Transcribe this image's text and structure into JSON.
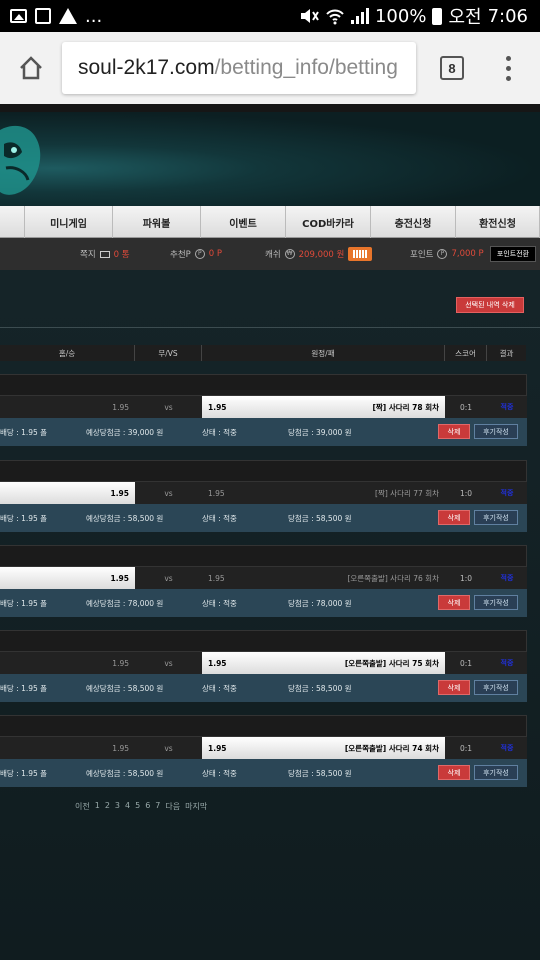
{
  "statusbar": {
    "dots": "...",
    "battery": "100%",
    "ampm": "오전",
    "time": "7:06"
  },
  "browser": {
    "url_host": "soul-2k17.com",
    "url_path": "/betting_info/betting",
    "tab_count": "8"
  },
  "nav": {
    "items": [
      "미니게임",
      "파워볼",
      "이벤트",
      "COD바카라",
      "충전신청",
      "환전신청"
    ]
  },
  "infobar": {
    "memo_label": "쪽지",
    "memo_value": "0 통",
    "recommend_label": "추천P",
    "recommend_value": "0 P",
    "cash_label": "캐쉬",
    "cash_value": "209,000 원",
    "point_label": "포인트",
    "point_value": "7,000 P",
    "point_button": "포인트전환"
  },
  "actions": {
    "delete_selected": "선택된 내역 삭제"
  },
  "table": {
    "headers": [
      "홈/승",
      "무/VS",
      "원정/패",
      "스코어",
      "결과"
    ]
  },
  "bets": [
    {
      "home_odds": "1.95",
      "vs": "vs",
      "away_odds": "1.95",
      "away_label": "[짝] 사다리 78 회차",
      "selected": "away",
      "score": "0:1",
      "result": "적중",
      "info_left": "배당 : 1.95 폴",
      "expected": "예상당첨금 : 39,000 원",
      "status": "상태 : 적중",
      "won": "당첨금 : 39,000 원",
      "delete": "삭제",
      "review": "후기작성"
    },
    {
      "home_odds": "1.95",
      "vs": "vs",
      "away_odds": "1.95",
      "away_label": "[짝] 사다리 77 회차",
      "selected": "home",
      "score": "1:0",
      "result": "적중",
      "info_left": "배당 : 1.95 폴",
      "expected": "예상당첨금 : 58,500 원",
      "status": "상태 : 적중",
      "won": "당첨금 : 58,500 원",
      "delete": "삭제",
      "review": "후기작성"
    },
    {
      "home_odds": "1.95",
      "vs": "vs",
      "away_odds": "1.95",
      "away_label": "[오른쪽출발] 사다리 76 회차",
      "selected": "home",
      "score": "1:0",
      "result": "적중",
      "info_left": "배당 : 1.95 폴",
      "expected": "예상당첨금 : 78,000 원",
      "status": "상태 : 적중",
      "won": "당첨금 : 78,000 원",
      "delete": "삭제",
      "review": "후기작성"
    },
    {
      "home_odds": "1.95",
      "vs": "vs",
      "away_odds": "1.95",
      "away_label": "[오른쪽출발] 사다리 75 회차",
      "selected": "away",
      "score": "0:1",
      "result": "적중",
      "info_left": "배당 : 1.95 폴",
      "expected": "예상당첨금 : 58,500 원",
      "status": "상태 : 적중",
      "won": "당첨금 : 58,500 원",
      "delete": "삭제",
      "review": "후기작성"
    },
    {
      "home_odds": "1.95",
      "vs": "vs",
      "away_odds": "1.95",
      "away_label": "[오른쪽출발] 사다리 74 회차",
      "selected": "away",
      "score": "0:1",
      "result": "적중",
      "info_left": "배당 : 1.95 폴",
      "expected": "예상당첨금 : 58,500 원",
      "status": "상태 : 적중",
      "won": "당첨금 : 58,500 원",
      "delete": "삭제",
      "review": "후기작성"
    }
  ],
  "pagination": {
    "prev": "이전",
    "pages": [
      "1",
      "2",
      "3",
      "4",
      "5",
      "6",
      "7"
    ],
    "next": "다음",
    "last": "마지막"
  },
  "colors": {
    "accent_red": "#c93a3a",
    "cash_orange": "#e8752b",
    "info_row_blue": "#2b4656",
    "result_blue": "#2030d8"
  }
}
